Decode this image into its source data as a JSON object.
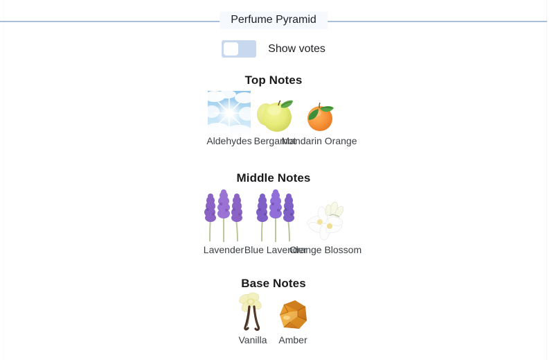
{
  "header": {
    "legend": "Perfume Pyramid",
    "rule_color": "#a9bedb",
    "legend_bg": "#f6f9fd"
  },
  "toggle": {
    "label": "Show votes",
    "state": "off",
    "track_color": "#c7d8ef",
    "knob_color": "#ffffff"
  },
  "sections": [
    {
      "title": "Top Notes",
      "notes": [
        {
          "label": "Aldehydes",
          "icon": "aldehydes-sky-sun-image"
        },
        {
          "label": "Bergamot",
          "icon": "bergamot-citrus-image"
        },
        {
          "label": "Mandarin Orange",
          "icon": "mandarin-orange-image"
        }
      ]
    },
    {
      "title": "Middle Notes",
      "notes": [
        {
          "label": "Lavender",
          "icon": "lavender-sprigs-image"
        },
        {
          "label": "Blue Lavender",
          "icon": "blue-lavender-sprigs-image"
        },
        {
          "label": "Orange Blossom",
          "icon": "orange-blossom-flower-image"
        }
      ]
    },
    {
      "title": "Base Notes",
      "notes": [
        {
          "label": "Vanilla",
          "icon": "vanilla-flower-pods-image"
        },
        {
          "label": "Amber",
          "icon": "amber-resin-image"
        }
      ]
    }
  ]
}
